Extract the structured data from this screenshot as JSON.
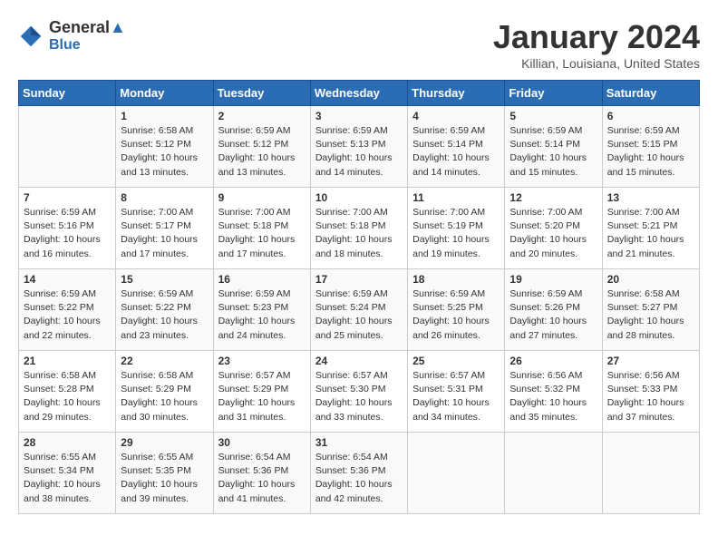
{
  "header": {
    "logo_line1": "General",
    "logo_line2": "Blue",
    "month_title": "January 2024",
    "location": "Killian, Louisiana, United States"
  },
  "days_of_week": [
    "Sunday",
    "Monday",
    "Tuesday",
    "Wednesday",
    "Thursday",
    "Friday",
    "Saturday"
  ],
  "weeks": [
    [
      {
        "day": "",
        "info": ""
      },
      {
        "day": "1",
        "info": "Sunrise: 6:58 AM\nSunset: 5:12 PM\nDaylight: 10 hours\nand 13 minutes."
      },
      {
        "day": "2",
        "info": "Sunrise: 6:59 AM\nSunset: 5:12 PM\nDaylight: 10 hours\nand 13 minutes."
      },
      {
        "day": "3",
        "info": "Sunrise: 6:59 AM\nSunset: 5:13 PM\nDaylight: 10 hours\nand 14 minutes."
      },
      {
        "day": "4",
        "info": "Sunrise: 6:59 AM\nSunset: 5:14 PM\nDaylight: 10 hours\nand 14 minutes."
      },
      {
        "day": "5",
        "info": "Sunrise: 6:59 AM\nSunset: 5:14 PM\nDaylight: 10 hours\nand 15 minutes."
      },
      {
        "day": "6",
        "info": "Sunrise: 6:59 AM\nSunset: 5:15 PM\nDaylight: 10 hours\nand 15 minutes."
      }
    ],
    [
      {
        "day": "7",
        "info": "Sunrise: 6:59 AM\nSunset: 5:16 PM\nDaylight: 10 hours\nand 16 minutes."
      },
      {
        "day": "8",
        "info": "Sunrise: 7:00 AM\nSunset: 5:17 PM\nDaylight: 10 hours\nand 17 minutes."
      },
      {
        "day": "9",
        "info": "Sunrise: 7:00 AM\nSunset: 5:18 PM\nDaylight: 10 hours\nand 17 minutes."
      },
      {
        "day": "10",
        "info": "Sunrise: 7:00 AM\nSunset: 5:18 PM\nDaylight: 10 hours\nand 18 minutes."
      },
      {
        "day": "11",
        "info": "Sunrise: 7:00 AM\nSunset: 5:19 PM\nDaylight: 10 hours\nand 19 minutes."
      },
      {
        "day": "12",
        "info": "Sunrise: 7:00 AM\nSunset: 5:20 PM\nDaylight: 10 hours\nand 20 minutes."
      },
      {
        "day": "13",
        "info": "Sunrise: 7:00 AM\nSunset: 5:21 PM\nDaylight: 10 hours\nand 21 minutes."
      }
    ],
    [
      {
        "day": "14",
        "info": "Sunrise: 6:59 AM\nSunset: 5:22 PM\nDaylight: 10 hours\nand 22 minutes."
      },
      {
        "day": "15",
        "info": "Sunrise: 6:59 AM\nSunset: 5:22 PM\nDaylight: 10 hours\nand 23 minutes."
      },
      {
        "day": "16",
        "info": "Sunrise: 6:59 AM\nSunset: 5:23 PM\nDaylight: 10 hours\nand 24 minutes."
      },
      {
        "day": "17",
        "info": "Sunrise: 6:59 AM\nSunset: 5:24 PM\nDaylight: 10 hours\nand 25 minutes."
      },
      {
        "day": "18",
        "info": "Sunrise: 6:59 AM\nSunset: 5:25 PM\nDaylight: 10 hours\nand 26 minutes."
      },
      {
        "day": "19",
        "info": "Sunrise: 6:59 AM\nSunset: 5:26 PM\nDaylight: 10 hours\nand 27 minutes."
      },
      {
        "day": "20",
        "info": "Sunrise: 6:58 AM\nSunset: 5:27 PM\nDaylight: 10 hours\nand 28 minutes."
      }
    ],
    [
      {
        "day": "21",
        "info": "Sunrise: 6:58 AM\nSunset: 5:28 PM\nDaylight: 10 hours\nand 29 minutes."
      },
      {
        "day": "22",
        "info": "Sunrise: 6:58 AM\nSunset: 5:29 PM\nDaylight: 10 hours\nand 30 minutes."
      },
      {
        "day": "23",
        "info": "Sunrise: 6:57 AM\nSunset: 5:29 PM\nDaylight: 10 hours\nand 31 minutes."
      },
      {
        "day": "24",
        "info": "Sunrise: 6:57 AM\nSunset: 5:30 PM\nDaylight: 10 hours\nand 33 minutes."
      },
      {
        "day": "25",
        "info": "Sunrise: 6:57 AM\nSunset: 5:31 PM\nDaylight: 10 hours\nand 34 minutes."
      },
      {
        "day": "26",
        "info": "Sunrise: 6:56 AM\nSunset: 5:32 PM\nDaylight: 10 hours\nand 35 minutes."
      },
      {
        "day": "27",
        "info": "Sunrise: 6:56 AM\nSunset: 5:33 PM\nDaylight: 10 hours\nand 37 minutes."
      }
    ],
    [
      {
        "day": "28",
        "info": "Sunrise: 6:55 AM\nSunset: 5:34 PM\nDaylight: 10 hours\nand 38 minutes."
      },
      {
        "day": "29",
        "info": "Sunrise: 6:55 AM\nSunset: 5:35 PM\nDaylight: 10 hours\nand 39 minutes."
      },
      {
        "day": "30",
        "info": "Sunrise: 6:54 AM\nSunset: 5:36 PM\nDaylight: 10 hours\nand 41 minutes."
      },
      {
        "day": "31",
        "info": "Sunrise: 6:54 AM\nSunset: 5:36 PM\nDaylight: 10 hours\nand 42 minutes."
      },
      {
        "day": "",
        "info": ""
      },
      {
        "day": "",
        "info": ""
      },
      {
        "day": "",
        "info": ""
      }
    ]
  ]
}
